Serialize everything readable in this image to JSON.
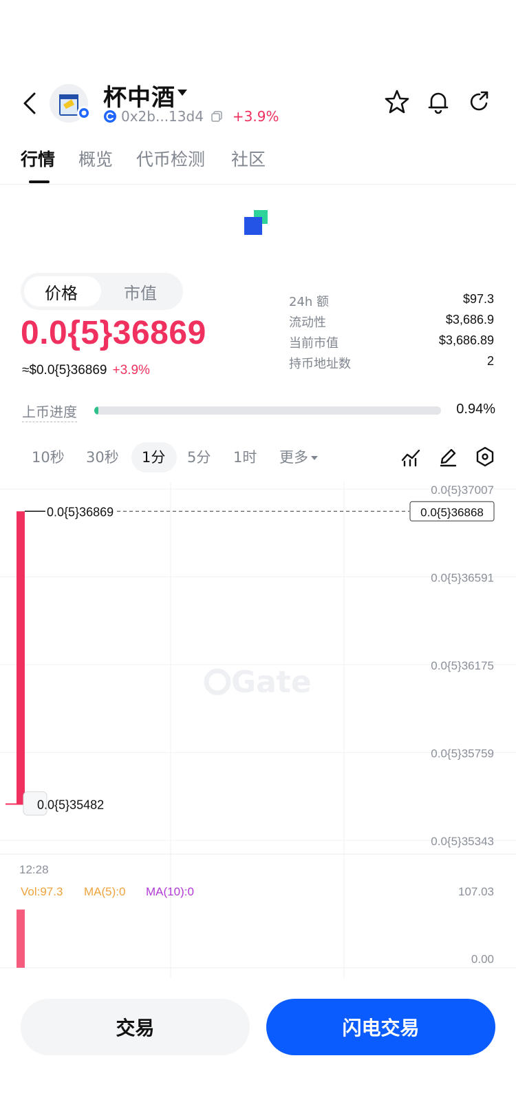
{
  "header": {
    "token_name": "杯中酒",
    "address": "0x2b...13d4",
    "change": "+3.9%",
    "icons": [
      "back-icon",
      "star-icon",
      "bell-icon",
      "share-icon",
      "copy-icon"
    ]
  },
  "tabs": [
    "行情",
    "概览",
    "代币检测",
    "社区"
  ],
  "toggle": {
    "price_label": "价格",
    "mcap_label": "市值"
  },
  "price": {
    "main": "0.0{5}36869",
    "usd": "≈$0.0{5}36869",
    "change": "+3.9%"
  },
  "stats": [
    {
      "label": "24h  额",
      "value": "$97.3"
    },
    {
      "label": "流动性",
      "value": "$3,686.9"
    },
    {
      "label": "当前市值",
      "value": "$3,686.89"
    },
    {
      "label": "持币地址数",
      "value": "2"
    }
  ],
  "progress": {
    "label": "上币进度",
    "value": "0.94%",
    "fraction": 0.0094
  },
  "intervals": [
    "10秒",
    "30秒",
    "1分",
    "5分",
    "1时",
    "更多"
  ],
  "active_interval": "1分",
  "chart_data": {
    "type": "candlestick",
    "y_axis_labels": [
      "0.0{5}37007",
      "0.0{5}36591",
      "0.0{5}36175",
      "0.0{5}35759",
      "0.0{5}35343"
    ],
    "current_price_tag": "0.0{5}36868",
    "high_label": "0.0{5}36869",
    "low_label": "0.0{5}35482",
    "x_label": "12:28",
    "watermark": "Gate",
    "candles": [
      {
        "time": "12:28",
        "open": 35482,
        "close": 36869,
        "high": 36869,
        "low": 35482,
        "unit": "×10^-10"
      }
    ],
    "volume": {
      "vol_label": "Vol:97.3",
      "ma5_label": "MA(5):0",
      "ma10_label": "MA(10):0",
      "axis_max": "107.03",
      "axis_min": "0.00",
      "values": [
        97.3
      ],
      "max": 107.03
    },
    "colors": {
      "up": "#f0305f",
      "ma5": "#f0a33c",
      "ma10": "#b13ad6"
    }
  },
  "buttons": {
    "trade": "交易",
    "flash_trade": "闪电交易"
  }
}
